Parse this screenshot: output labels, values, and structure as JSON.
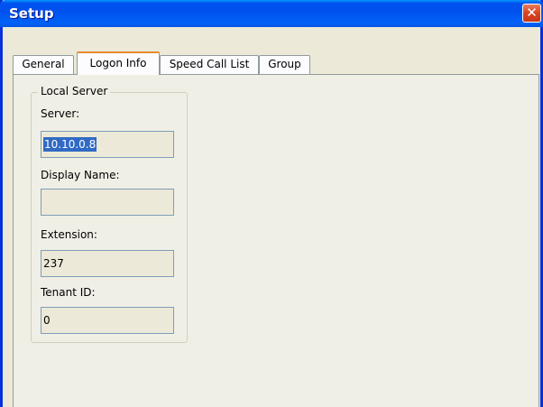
{
  "window": {
    "title": "Setup",
    "close_icon": "close-icon"
  },
  "tabs": [
    {
      "label": "General"
    },
    {
      "label": "Logon Info"
    },
    {
      "label": "Speed Call List"
    },
    {
      "label": "Group"
    }
  ],
  "local_server": {
    "legend": "Local Server",
    "server_label": "Server:",
    "server_value": "10.10.0.8",
    "display_name_label": "Display Name:",
    "display_name_value": "",
    "extension_label": "Extension:",
    "extension_value": "237",
    "tenant_id_label": "Tenant ID:",
    "tenant_id_value": "0"
  }
}
